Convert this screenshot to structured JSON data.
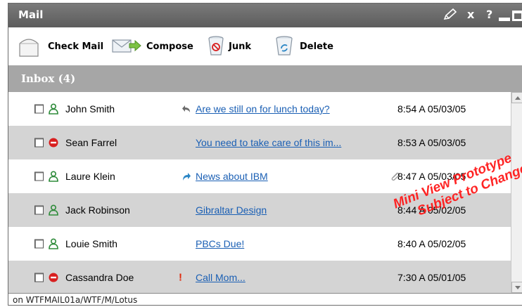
{
  "window": {
    "title": "Mail",
    "controls": {
      "close": "x",
      "help": "?"
    }
  },
  "toolbar": {
    "check_mail": "Check Mail",
    "compose": "Compose",
    "junk": "Junk",
    "delete": "Delete"
  },
  "inbox": {
    "header": "Inbox (4)"
  },
  "messages": [
    {
      "sender": "John Smith",
      "presence": "online",
      "indicator": "reply-arrow",
      "subject": "Are we still on for lunch today?",
      "attachment": false,
      "time": "8:54 A  05/03/05"
    },
    {
      "sender": "Sean Farrel",
      "presence": "do-not-disturb",
      "indicator": "",
      "subject": "You need to take care of this im...",
      "attachment": false,
      "time": "8:53 A  05/03/05"
    },
    {
      "sender": "Laure Klein",
      "presence": "online",
      "indicator": "forward-arrow",
      "subject": "News about IBM",
      "attachment": true,
      "time": "8:47 A  05/03/05"
    },
    {
      "sender": "Jack Robinson",
      "presence": "online",
      "indicator": "",
      "subject": "Gibraltar Design",
      "attachment": false,
      "time": "8:44 A  05/02/05"
    },
    {
      "sender": "Louie Smith",
      "presence": "online",
      "indicator": "",
      "subject": "PBCs Due!",
      "attachment": false,
      "time": "8:40 A  05/02/05"
    },
    {
      "sender": "Cassandra Doe",
      "presence": "do-not-disturb",
      "indicator": "!",
      "subject": "Call Mom...",
      "attachment": false,
      "time": "7:30 A  05/01/05"
    }
  ],
  "status": {
    "text": "on WTFMAIL01a/WTF/M/Lotus"
  },
  "watermark": {
    "line1": "Mini View Prototype",
    "line2": "Subject to Change"
  },
  "colors": {
    "titlebar": "#6b6b6b",
    "inbox_header": "#a6a6a6",
    "alt_row": "#d4d4d4",
    "link": "#1a5fb4",
    "watermark": "#ff1a1a",
    "presence_online": "#2e8b3a",
    "presence_dnd": "#d81f1f"
  }
}
